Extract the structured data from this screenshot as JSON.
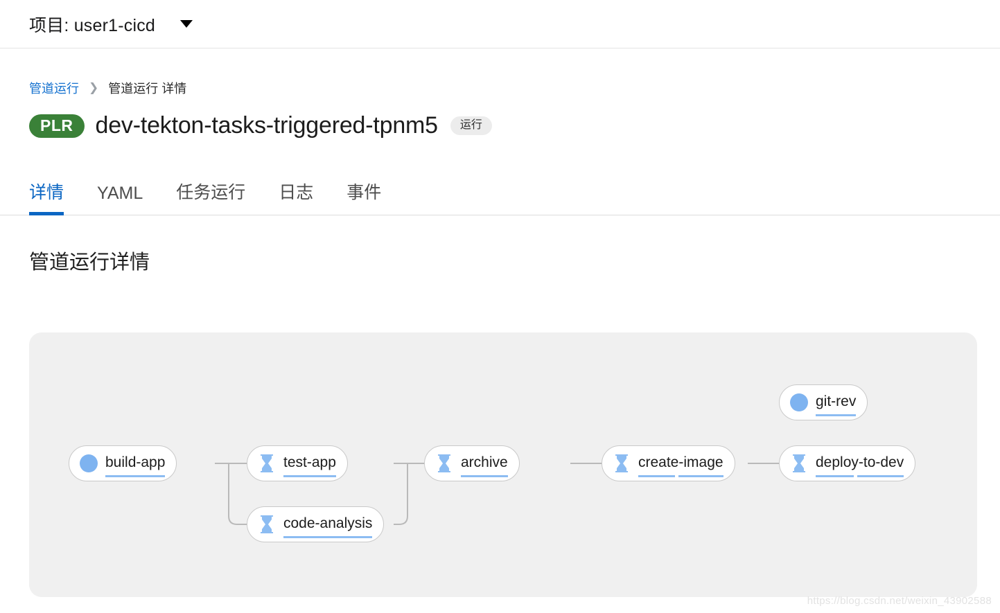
{
  "project_bar": {
    "label": "项目: user1-cicd",
    "caret_icon": "chevron-down-icon"
  },
  "breadcrumb": {
    "parent": "管道运行",
    "separator": "❯",
    "current": "管道运行 详情"
  },
  "header": {
    "badge": "PLR",
    "badge_color": "#3a8138",
    "title": "dev-tekton-tasks-triggered-tpnm5",
    "status": "运行",
    "status_bg": "#ececec"
  },
  "tabs": [
    {
      "label": "详情",
      "active": true
    },
    {
      "label": "YAML",
      "active": false
    },
    {
      "label": "任务运行",
      "active": false
    },
    {
      "label": "日志",
      "active": false
    },
    {
      "label": "事件",
      "active": false
    }
  ],
  "section": {
    "heading": "管道运行详情"
  },
  "graph": {
    "accent_blue": "#8cbcf2",
    "panel_bg": "#f0f0f0",
    "nodes": [
      {
        "id": "git-rev",
        "label": "git-rev",
        "icon": "running-dot-icon",
        "status": "running",
        "split_underline": false
      },
      {
        "id": "build-app",
        "label": "build-app",
        "icon": "running-dot-icon",
        "status": "running",
        "split_underline": false
      },
      {
        "id": "test-app",
        "label": "test-app",
        "icon": "hourglass-icon",
        "status": "pending",
        "split_underline": false
      },
      {
        "id": "code-analysis",
        "label": "code-analysis",
        "icon": "hourglass-icon",
        "status": "pending",
        "split_underline": false
      },
      {
        "id": "archive",
        "label": "archive",
        "icon": "hourglass-icon",
        "status": "pending",
        "split_underline": false
      },
      {
        "id": "create-image",
        "label": "create-image",
        "icon": "hourglass-icon",
        "status": "pending",
        "split_underline": true
      },
      {
        "id": "deploy-to-dev",
        "label": "deploy-to-dev",
        "icon": "hourglass-icon",
        "status": "pending",
        "split_underline": true
      }
    ]
  },
  "watermark": "https://blog.csdn.net/weixin_43902588"
}
